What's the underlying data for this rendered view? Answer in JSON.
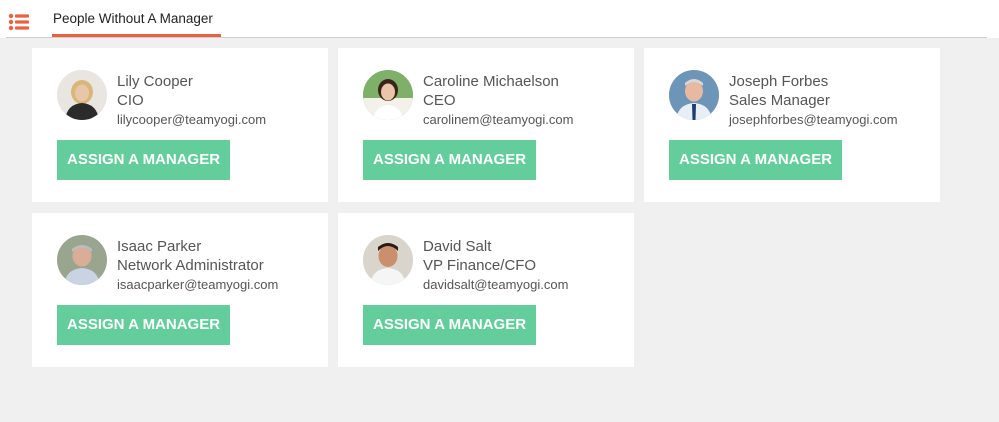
{
  "header": {
    "menu_icon": "list-icon",
    "tab_label": "People Without A Manager",
    "accent_color": "#e8623f"
  },
  "button_color": "#63cd9c",
  "people": [
    {
      "name": "Lily Cooper",
      "title": "CIO",
      "email": "lilycooper@teamyogi.com",
      "button_label": "ASSIGN A MANAGER"
    },
    {
      "name": "Caroline Michaelson",
      "title": "CEO",
      "email": "carolinem@teamyogi.com",
      "button_label": "ASSIGN A MANAGER"
    },
    {
      "name": "Joseph Forbes",
      "title": "Sales Manager",
      "email": "josephforbes@teamyogi.com",
      "button_label": "ASSIGN A MANAGER"
    },
    {
      "name": "Isaac Parker",
      "title": "Network Administrator",
      "email": "isaacparker@teamyogi.com",
      "button_label": "ASSIGN A MANAGER"
    },
    {
      "name": "David Salt",
      "title": "VP Finance/CFO",
      "email": "davidsalt@teamyogi.com",
      "button_label": "ASSIGN A MANAGER"
    }
  ]
}
